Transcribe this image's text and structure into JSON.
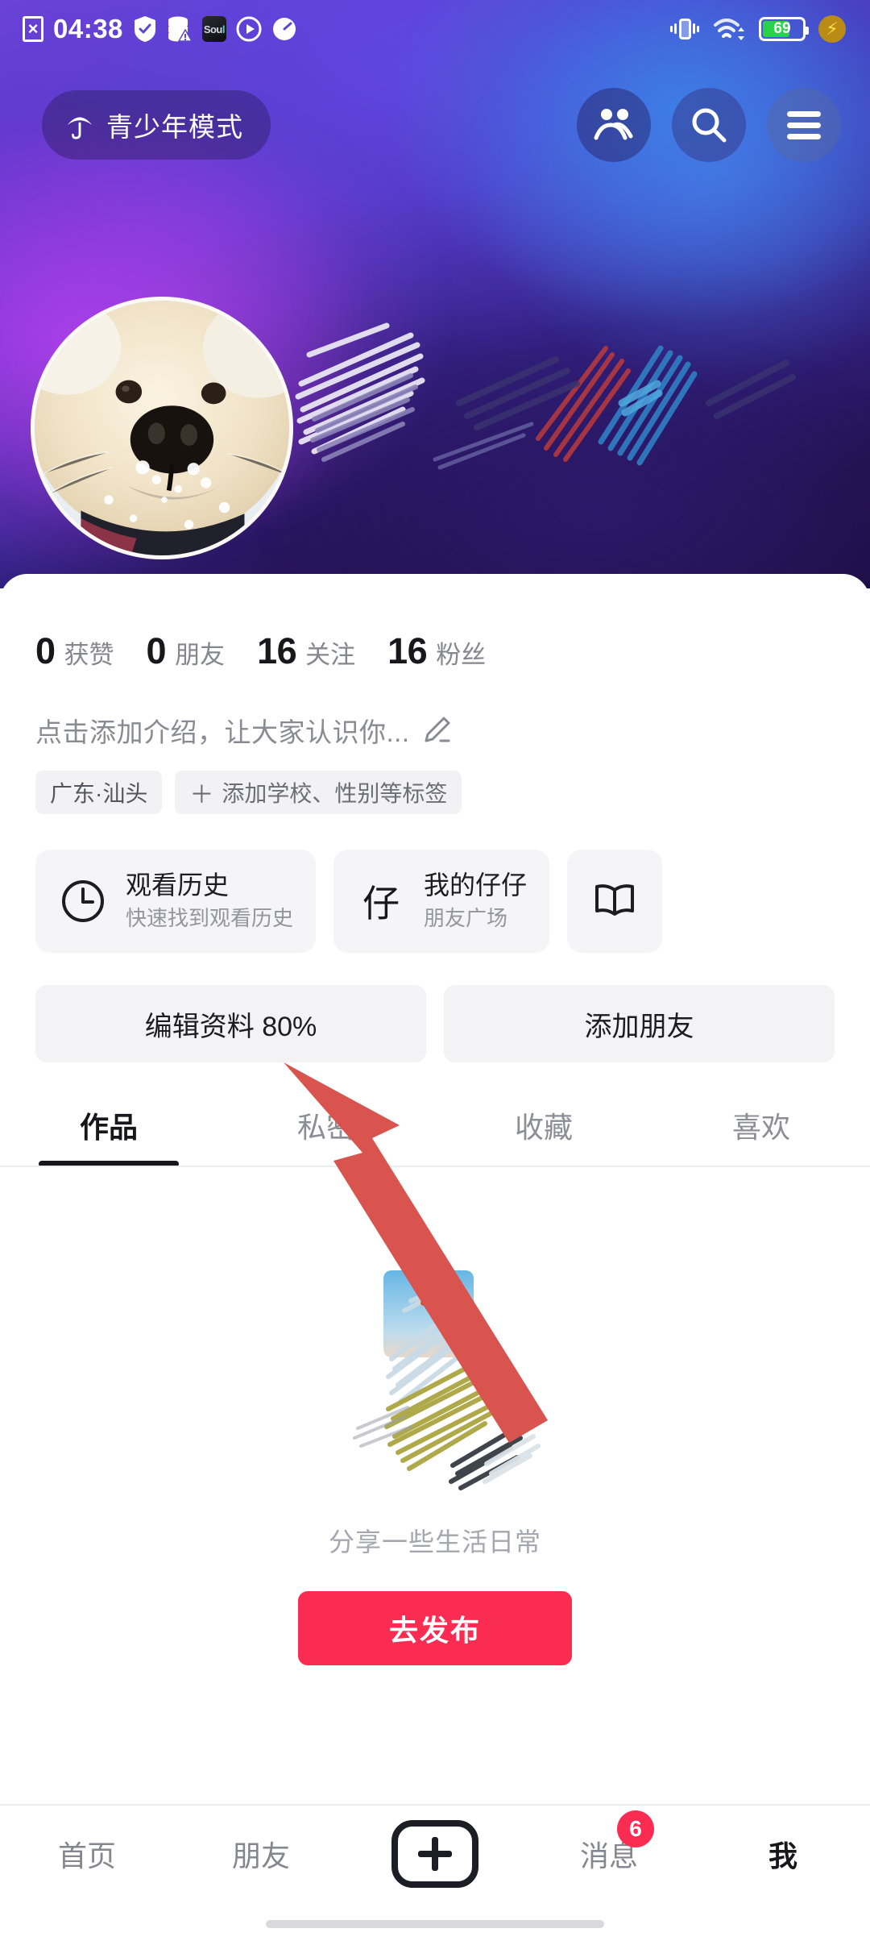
{
  "status_bar": {
    "time": "04:38",
    "battery_percent": "69",
    "left_icons": [
      "no-sim-icon",
      "shield-check-icon",
      "database-warning-icon",
      "soul-app-icon",
      "play-circle-icon",
      "speedometer-icon"
    ],
    "right_icons": [
      "vibrate-icon",
      "wifi-icon",
      "battery-icon",
      "fast-charge-icon"
    ],
    "soul_badge_text": "Sou",
    "soul_badge_accent": "l"
  },
  "header": {
    "teen_mode_label": "青少年模式",
    "icons": {
      "friends": "friends-icon",
      "search": "search-icon",
      "menu": "hamburger-menu-icon"
    }
  },
  "profile": {
    "avatar_alt": "golden retriever puppy in snow",
    "banner_note": "username scribbled out"
  },
  "stats": [
    {
      "num": "0",
      "label": "获赞"
    },
    {
      "num": "0",
      "label": "朋友"
    },
    {
      "num": "16",
      "label": "关注"
    },
    {
      "num": "16",
      "label": "粉丝"
    }
  ],
  "bio": {
    "placeholder": "点击添加介绍，让大家认识你...",
    "edit_icon": "pencil-icon"
  },
  "tags": {
    "location": "广东·汕头",
    "add_label": "添加学校、性别等标签",
    "add_plus": "＋"
  },
  "cards": [
    {
      "icon": "clock-icon",
      "title": "观看历史",
      "subtitle": "快速找到观看历史"
    },
    {
      "icon": "zaizai-icon",
      "glyph": "仔",
      "title": "我的仔仔",
      "subtitle": "朋友广场"
    },
    {
      "icon": "book-icon",
      "title": "",
      "subtitle": ""
    }
  ],
  "actions": {
    "edit_profile": "编辑资料 80%",
    "add_friend": "添加朋友"
  },
  "tabs": [
    {
      "label": "作品",
      "active": true
    },
    {
      "label": "私密",
      "active": false
    },
    {
      "label": "收藏",
      "active": false
    },
    {
      "label": "喜欢",
      "active": false
    }
  ],
  "empty_state": {
    "caption": "分享一些生活日常",
    "publish_label": "去发布",
    "accent_color": "#fa2c52"
  },
  "bottom_nav": [
    {
      "label": "首页",
      "active": false,
      "badge": ""
    },
    {
      "label": "朋友",
      "active": false,
      "badge": ""
    },
    {
      "label": "",
      "active": false,
      "badge": "",
      "icon": "plus-box-icon"
    },
    {
      "label": "消息",
      "active": false,
      "badge": "6"
    },
    {
      "label": "我",
      "active": true,
      "badge": ""
    }
  ],
  "annotation": {
    "arrow_color": "#d9534f",
    "points_to": "编辑资料 80%"
  },
  "colors": {
    "banner_purple": "#6a42d8",
    "banner_blue": "#3878e2",
    "banner_dark": "#1d0e44",
    "accent_red": "#fa2c52",
    "text_primary": "#17171c",
    "text_secondary": "#86868e",
    "chip_bg": "#f2f2f4"
  }
}
